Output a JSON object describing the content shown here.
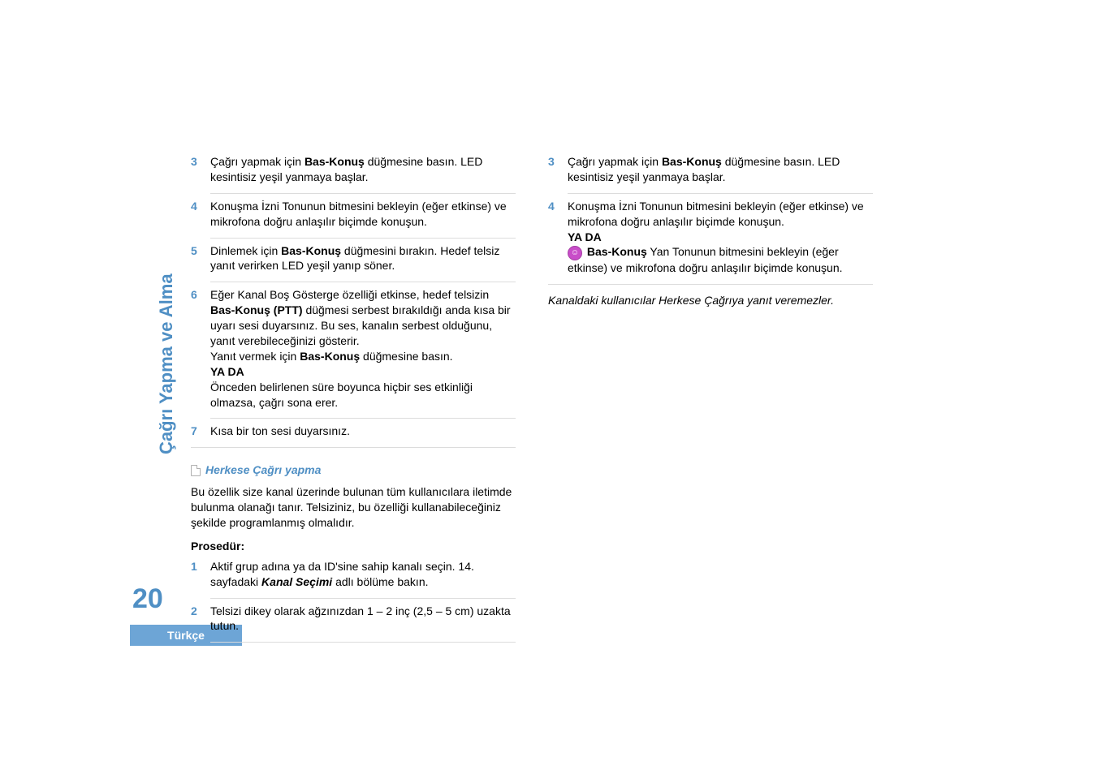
{
  "sidebar": {
    "section_title": "Çağrı Yapma ve Alma",
    "page_number": "20",
    "language_label": "Türkçe"
  },
  "left_column": {
    "items": [
      {
        "num": "3",
        "pre": "Çağrı yapmak için ",
        "bold": "Bas-Konuş",
        "post": " düğmesine basın. LED kesintisiz yeşil yanmaya başlar."
      },
      {
        "num": "4",
        "text": "Konuşma İzni Tonunun bitmesini bekleyin (eğer etkinse) ve mikrofona doğru anlaşılır biçimde konuşun."
      },
      {
        "num": "5",
        "pre": "Dinlemek için ",
        "bold": "Bas-Konuş",
        "post": " düğmesini bırakın. Hedef telsiz yanıt verirken LED yeşil yanıp söner."
      },
      {
        "num": "6",
        "pre": "Eğer Kanal Boş Gösterge özelliği etkinse, hedef telsizin ",
        "bold1": "Bas-Konuş (PTT)",
        "mid": " düğmesi serbest bırakıldığı anda kısa bir uyarı sesi duyarsınız. Bu ses, kanalın serbest olduğunu, yanıt verebileceğinizi gösterir.",
        "line2_pre": "Yanıt vermek için ",
        "line2_bold": "Bas-Konuş",
        "line2_post": " düğmesine basın.",
        "or": "YA DA",
        "after_or": "Önceden belirlenen süre boyunca hiçbir ses etkinliği olmazsa, çağrı sona erer."
      },
      {
        "num": "7",
        "text": "Kısa bir ton sesi duyarsınız."
      }
    ],
    "subheading": "Herkese Çağrı yapma",
    "subdesc": "Bu özellik size kanal üzerinde bulunan tüm kullanıcılara iletimde bulunma olanağı tanır. Telsiziniz, bu özelliği kullanabileceğiniz şekilde programlanmış olmalıdır.",
    "prosedur": "Prosedür:",
    "proc_items": [
      {
        "num": "1",
        "pre": "Aktif grup adına ya da ID'sine sahip kanalı seçin. 14. sayfadaki ",
        "ital": "Kanal Seçimi",
        "post": " adlı bölüme bakın."
      },
      {
        "num": "2",
        "text": "Telsizi dikey olarak ağzınızdan 1 – 2 inç (2,5 – 5 cm) uzakta tutun."
      }
    ]
  },
  "right_column": {
    "items": [
      {
        "num": "3",
        "pre": "Çağrı yapmak için ",
        "bold": "Bas-Konuş",
        "post": " düğmesine basın. LED kesintisiz yeşil yanmaya başlar."
      },
      {
        "num": "4",
        "line1": "Konuşma İzni Tonunun bitmesini bekleyin (eğer etkinse) ve mikrofona doğru anlaşılır biçimde konuşun.",
        "or": "YA DA",
        "icon_label": "smile",
        "after_bold": "Bas-Konuş",
        "after_text": " Yan Tonunun bitmesini bekleyin (eğer etkinse) ve mikrofona doğru anlaşılır biçimde konuşun."
      }
    ],
    "note": "Kanaldaki kullanıcılar Herkese Çağrıya yanıt veremezler."
  }
}
